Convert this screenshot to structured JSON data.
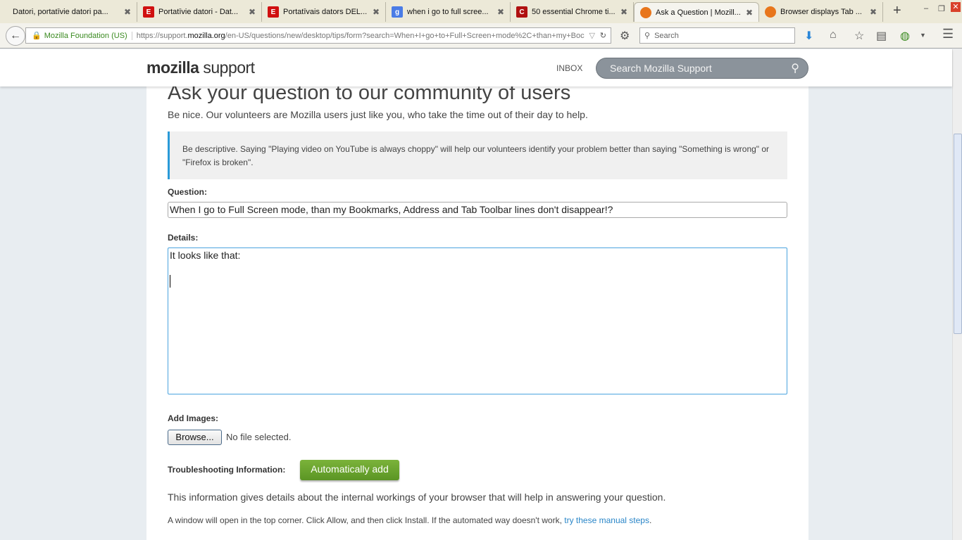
{
  "tabs": [
    {
      "title": "Datori, portatīvie datori pa...",
      "icon": "none",
      "color": ""
    },
    {
      "title": "Portatīvie datori - Dat...",
      "icon": "e-icon",
      "color": "#d01010"
    },
    {
      "title": "Portatīvais dators DEL...",
      "icon": "e-icon",
      "color": "#d01010"
    },
    {
      "title": "when i go to full scree...",
      "icon": "google-icon",
      "color": "#4a7ce6"
    },
    {
      "title": "50 essential Chrome ti...",
      "icon": "c-icon",
      "color": "#b01010"
    },
    {
      "title": "Ask a Question | Mozill...",
      "icon": "firefox-icon",
      "color": "#e8761c",
      "active": true
    },
    {
      "title": "Browser displays Tab ...",
      "icon": "firefox-icon",
      "color": "#e8761c"
    }
  ],
  "navbar": {
    "identity": "Mozilla Foundation (US)",
    "url_prefix": "https://support.",
    "url_domain": "mozilla.org",
    "url_rest": "/en-US/questions/new/desktop/tips/form?search=When+I+go+to+Full+Screen+mode%2C+than+my+Boc",
    "search_placeholder": "Search"
  },
  "header": {
    "logo_bold": "mozilla",
    "logo_rest": " support",
    "inbox": "INBOX",
    "search_placeholder": "Search Mozilla Support"
  },
  "main": {
    "title": "Ask your question to our community of users",
    "subtitle": "Be nice. Our volunteers are Mozilla users just like you, who take the time out of their day to help.",
    "note": "Be descriptive. Saying \"Playing video on YouTube is always choppy\" will help our volunteers identify your problem better than saying \"Something is wrong\" or \"Firefox is broken\".",
    "question_label": "Question:",
    "question_value": "When I go to Full Screen mode, than my Bookmarks, Address and Tab Toolbar lines don't disappear!?",
    "details_label": "Details:",
    "details_value": "It looks like that:",
    "images_label": "Add Images:",
    "browse_label": "Browse...",
    "no_file": "No file selected.",
    "troubleshooting_label": "Troubleshooting Information:",
    "auto_add": "Automatically add",
    "info": "This information gives details about the internal workings of your browser that will help in answering your question.",
    "window_text": "A window will open in the top corner. Click Allow, and then click Install. If the automated way doesn't work, ",
    "manual_link": "try these manual steps",
    "window_end": "."
  }
}
